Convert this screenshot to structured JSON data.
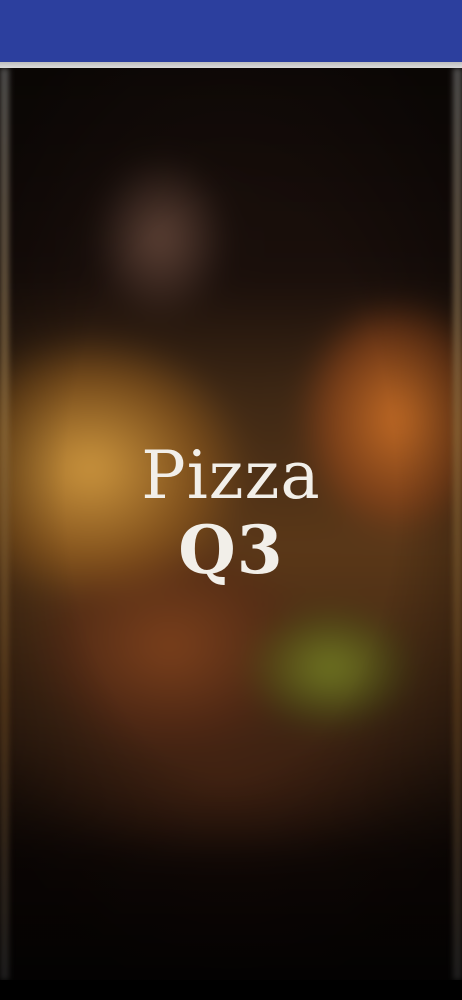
{
  "splash": {
    "title": "Pizza",
    "subtitle": "Q3"
  },
  "colors": {
    "app_bar": "#2c3f9e",
    "title_text": "#f2efe9",
    "nav_bar": "#000000"
  }
}
